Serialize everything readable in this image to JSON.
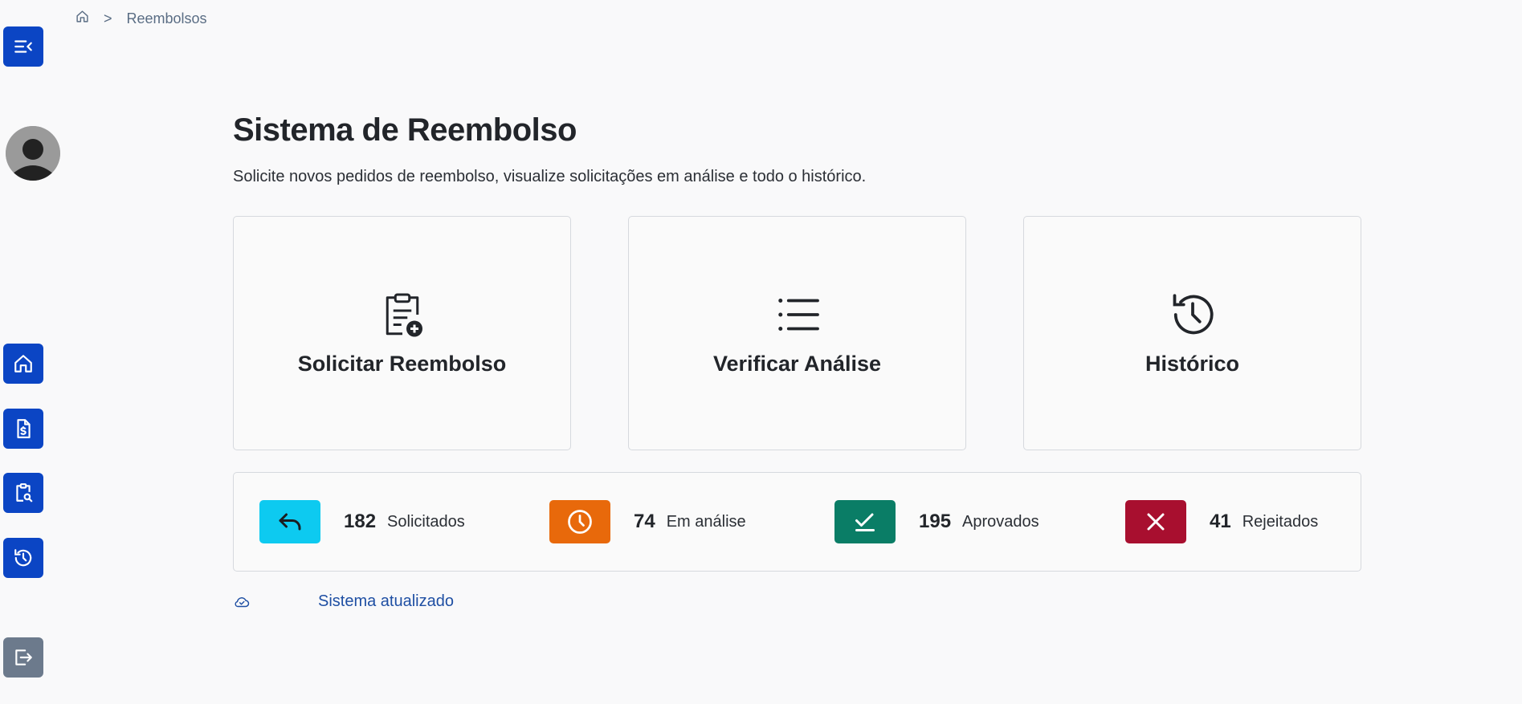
{
  "breadcrumb": {
    "home_icon": "home-icon",
    "separator": ">",
    "current": "Reembolsos"
  },
  "sidebar": {
    "toggle_icon": "menu-collapse-icon",
    "avatar_icon": "user-avatar-icon",
    "items": [
      {
        "icon": "home-icon"
      },
      {
        "icon": "invoice-dollar-icon"
      },
      {
        "icon": "clipboard-search-icon"
      },
      {
        "icon": "history-icon"
      }
    ],
    "logout_icon": "logout-icon"
  },
  "main": {
    "title": "Sistema de Reembolso",
    "description": "Solicite novos pedidos de reembolso, visualize solicitações em análise e todo o histórico."
  },
  "cards": [
    {
      "label": "Solicitar Reembolso",
      "icon": "clipboard-add-icon"
    },
    {
      "label": "Verificar Análise",
      "icon": "list-icon"
    },
    {
      "label": "Histórico",
      "icon": "history-icon"
    }
  ],
  "stats": [
    {
      "value": "182",
      "label": "Solicitados",
      "icon": "reply-icon",
      "color": "#0dcaf0"
    },
    {
      "value": "74",
      "label": "Em análise",
      "icon": "clock-icon",
      "color": "#e8690b"
    },
    {
      "value": "195",
      "label": "Aprovados",
      "icon": "check-icon",
      "color": "#0a7d66"
    },
    {
      "value": "41",
      "label": "Rejeitados",
      "icon": "x-icon",
      "color": "#a80f2f"
    }
  ],
  "status": {
    "icon": "cloud-check-icon",
    "text": "Sistema atualizado"
  },
  "colors": {
    "primary": "#0b45c4",
    "logout": "#6c7a8c",
    "background": "#f9f9fa"
  }
}
